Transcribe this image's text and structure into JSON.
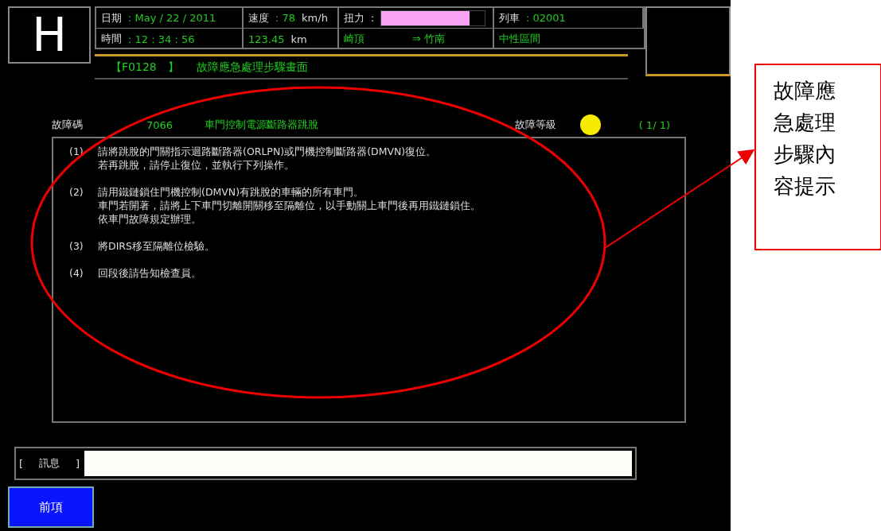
{
  "screen": {
    "mode": "H",
    "header": {
      "date_label": "日期",
      "date": ": May   / 22 / 2011",
      "time_label": "時間",
      "time": ":   12 : 34 : 56",
      "speed_label": "速度",
      "speed": ": 78",
      "speed_unit": "km/h",
      "distance": "123.45",
      "distance_unit": "km",
      "torque_label": "扭力",
      "torque_sep": ":",
      "torque": {
        "level": 0.85
      },
      "train_label": "列車",
      "train": ": 02001",
      "from": "崎頂",
      "to": "⇒ 竹南",
      "section": "中性區間"
    },
    "title": {
      "code": "【F0128　】",
      "text": "故障應急處理步驟畫面"
    },
    "fault": {
      "code_label": "故障碼",
      "code": "7066",
      "name": "車門控制電源斷路器跳脫",
      "level_label": "故障等級",
      "page": "( 1/ 1)"
    },
    "steps": [
      {
        "number": "(1)",
        "lines": [
          "請將跳脫的門關指示迴路斷路器(ORLPN)或門機控制斷路器(DMVN)復位。",
          "若再跳脫，請停止復位，並執行下列操作。"
        ]
      },
      {
        "number": "(2)",
        "lines": [
          "請用鐵鏈鎖住門機控制(DMVN)有跳脫的車輛的所有車門。",
          "車門若開著，請將上下車門切離開關移至隔離位，以手動關上車門後再用鐵鏈鎖住。",
          "依車門故障規定辦理。"
        ]
      },
      {
        "number": "(3)",
        "lines": [
          "將DIRS移至隔離位檢驗。"
        ]
      },
      {
        "number": "(4)",
        "lines": [
          "回段後請告知檢查員。"
        ]
      }
    ],
    "message": {
      "label_open": "[",
      "label": "訊息",
      "label_close": "]"
    },
    "buttons": [
      {
        "label": "前項"
      }
    ]
  },
  "annotation": {
    "text": "故障應急處理步驟內容提示"
  }
}
